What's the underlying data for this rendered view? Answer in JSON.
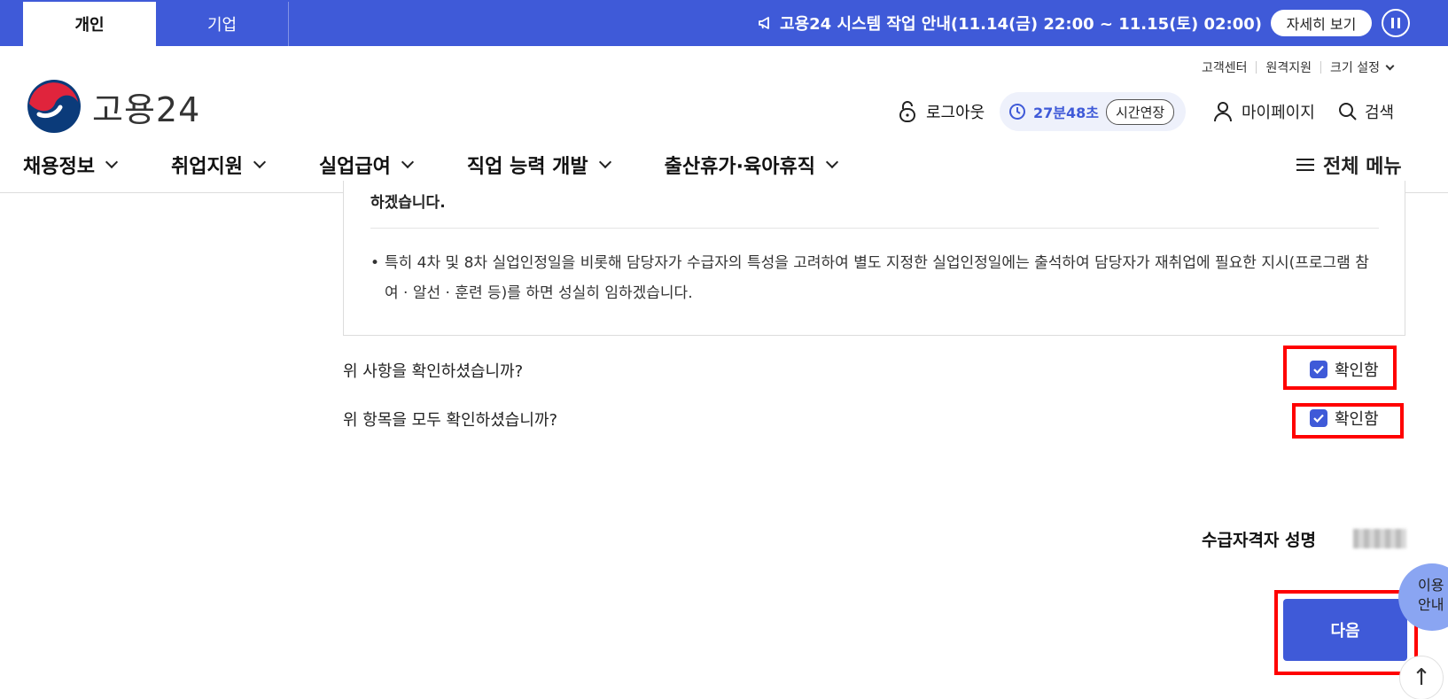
{
  "topbar": {
    "tabs": [
      {
        "label": "개인",
        "active": true
      },
      {
        "label": "기업",
        "active": false
      }
    ],
    "notice_text": "고용24 시스템 작업 안내(11.14(금) 22:00 ~ 11.15(토) 02:00)",
    "detail_button": "자세히 보기",
    "pause_icon": "pause-icon",
    "color": "#3f5ad8"
  },
  "header": {
    "util_links": [
      "고객센터",
      "원격지원",
      "크기 설정"
    ],
    "logo_text": "고용24",
    "logout_label": "로그아웃",
    "session_time": "27분48초",
    "extend_label": "시간연장",
    "mypage_label": "마이페이지",
    "search_label": "검색"
  },
  "nav": {
    "items": [
      "채용정보",
      "취업지원",
      "실업급여",
      "직업 능력 개발",
      "출산휴가·육아휴직"
    ],
    "all_menu": "전체 메뉴"
  },
  "content": {
    "box_top_text": "하겠습니다.",
    "bullet": "특히 4차 및 8차 실업인정일을 비롯해 담당자가 수급자의 특성을 고려하여 별도 지정한 실업인정일에는 출석하여 담당자가 재취업에 필요한 지시(프로그램 참여 · 알선 · 훈련 등)를 하면 성실히 임하겠습니다.",
    "questions": [
      {
        "text": "위 사항을 확인하셨습니까?",
        "check_label": "확인함",
        "checked": true
      },
      {
        "text": "위 항목을 모두 확인하셨습니까?",
        "check_label": "확인함",
        "checked": true
      }
    ],
    "signature_label": "수급자격자 성명",
    "next_button": "다음"
  },
  "floating": {
    "guide_line1": "이용",
    "guide_line2": "안내",
    "top_arrow": "↑"
  }
}
